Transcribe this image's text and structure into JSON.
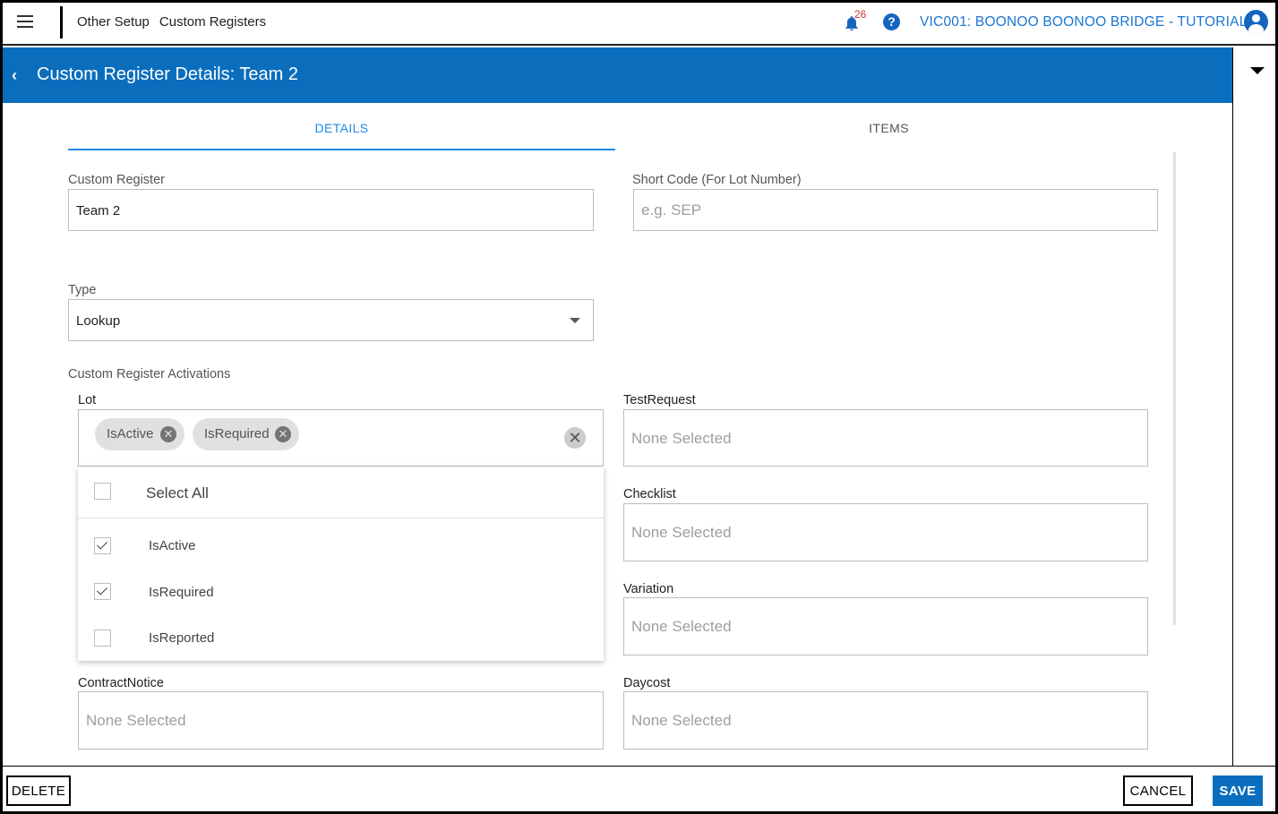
{
  "topbar": {
    "breadcrumbs": [
      "Other Setup",
      "Custom Registers"
    ],
    "notification_count": "26",
    "help_glyph": "?",
    "project": "VIC001: BOONOO BOONOO BRIDGE - TUTORIAL",
    "icons": [
      "menu-icon",
      "bell-icon",
      "help-icon",
      "account-icon"
    ]
  },
  "header": {
    "back_glyph": "‹",
    "title": "Custom Register Details: Team 2",
    "brand_color": "#0a6ebd"
  },
  "tabs": [
    {
      "label": "DETAILS",
      "active": true
    },
    {
      "label": "ITEMS",
      "active": false
    }
  ],
  "form": {
    "custom_register": {
      "label": "Custom Register",
      "value": "Team 2"
    },
    "short_code": {
      "label": "Short Code (For Lot Number)",
      "placeholder": "e.g. SEP"
    },
    "type": {
      "label": "Type",
      "value": "Lookup"
    },
    "activations_title": "Custom Register Activations",
    "lot": {
      "label": "Lot",
      "chips": [
        "IsActive",
        "IsRequired"
      ],
      "dropdown": {
        "select_all": "Select All",
        "options": [
          {
            "label": "IsActive",
            "checked": true
          },
          {
            "label": "IsRequired",
            "checked": true
          },
          {
            "label": "IsReported",
            "checked": false
          }
        ]
      }
    },
    "none_selected": "None Selected",
    "test_request": {
      "label": "TestRequest"
    },
    "checklist": {
      "label": "Checklist"
    },
    "variation": {
      "label": "Variation"
    },
    "contract_notice": {
      "label": "ContractNotice"
    },
    "daycost": {
      "label": "Daycost"
    }
  },
  "footer": {
    "delete": "DELETE",
    "cancel": "CANCEL",
    "save": "SAVE"
  }
}
